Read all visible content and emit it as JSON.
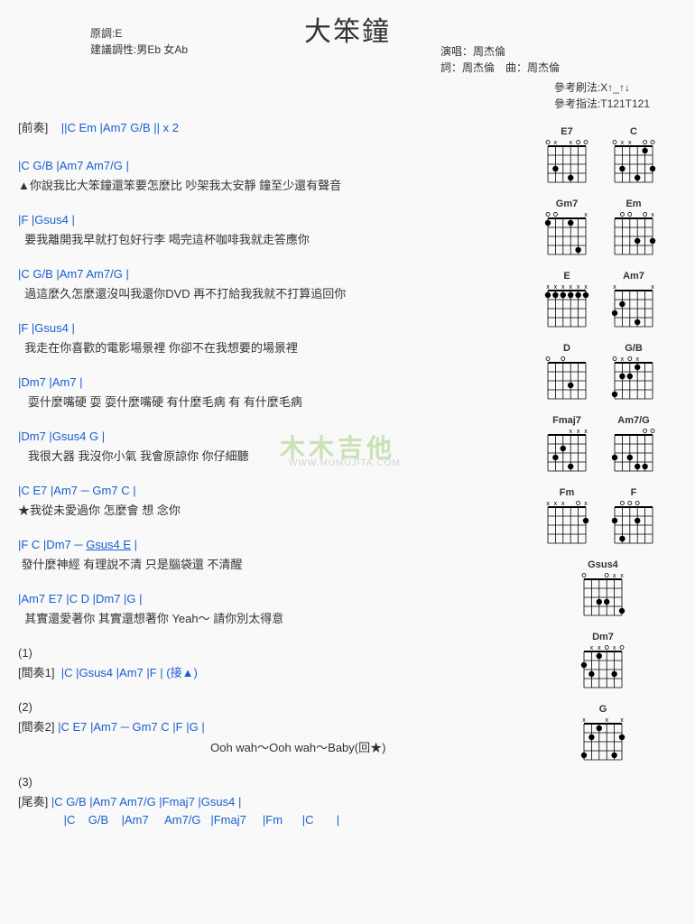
{
  "title": "大笨鐘",
  "meta_left": {
    "line1": "原調:E",
    "line2": "建議調性:男Eb 女Ab"
  },
  "meta_right": {
    "line1": "演唱：周杰倫",
    "line2": "詞：周杰倫　曲：周杰倫"
  },
  "meta_right2": {
    "line1": "參考刷法:X↑_↑↓",
    "line2": "參考指法:T121T121"
  },
  "watermark": "木木吉他",
  "watermark_sub": "WWW.MUMUJITA.COM",
  "intro": {
    "label": "[前奏]",
    "chords": "||C  Em      |Am7  G/B     || x 2"
  },
  "verses": [
    {
      "chords": "|C                   G/B               |Am7                   Am7/G            |",
      "lyrics": "▲你說我比大笨鐘還笨要怎麼比    吵架我太安靜 鐘至少還有聲音"
    },
    {
      "chords": "|F                                     |Gsus4                                   |",
      "lyrics": "要我離開我早就打包好行李    喝完這杯咖啡我就走答應你"
    },
    {
      "chords": "|C                        G/B              |Am7                  Am7/G            |",
      "lyrics": "過這麼久怎麼還沒叫我還你DVD    再不打給我我就不打算追回你"
    },
    {
      "chords": "|F                                     |Gsus4                                   |",
      "lyrics": "我走在你喜歡的電影場景裡    你卻不在我想要的場景裡"
    },
    {
      "chords": "|Dm7                                |Am7                                    |",
      "lyrics": "耍什麼嘴硬 耍 耍什麼嘴硬    有什麼毛病 有 有什麼毛病"
    },
    {
      "chords": "|Dm7                                |Gsus4      G                          |",
      "lyrics": "我很大器    我沒你小氣    我會原諒你    你仔細聽"
    },
    {
      "chords": "|C         E7         |Am7  ─  Gm7      C      |",
      "lyrics": "★我從未愛過你    怎麼會        想 念你"
    },
    {
      "chords_parts": [
        "|F             C              |Dm7  ─  ",
        "Gsus4   E",
        "   |"
      ],
      "lyrics": "發什麼神經   有理說不清 只是腦袋還    不清醒"
    },
    {
      "chords": "|Am7       E7         |C        D         |Dm7       |G                      |",
      "lyrics": "其實還愛著你    其實還想著你    Yeah～ 請你別太得意"
    }
  ],
  "endings": {
    "n1": "(1)",
    "inter1_label": "[間奏1]",
    "inter1": "|C    |Gsus4    |Am7    |F      |  (接▲)",
    "n2": "(2)",
    "inter2_label": "[間奏2]",
    "inter2": "  |C    E7    |Am7  ─  Gm7   C    |F        |G                       |",
    "inter2_lyrics": "                                                           Ooh wah～Ooh wah～Baby(回★)",
    "n3": "(3)",
    "outro_label": "[尾奏]",
    "outro1": "  |C    G/B    |Am7     Am7/G   |Fmaj7     |Gsus4    |",
    "outro2": "              |C    G/B    |Am7     Am7/G   |Fmaj7     |Fm      |C       |"
  },
  "chord_diagrams": [
    "E7",
    "C",
    "Gm7",
    "Em",
    "E",
    "Am7",
    "D",
    "G/B",
    "Fmaj7",
    "Am7/G",
    "Fm",
    "F",
    "Gsus4",
    "Dm7",
    "G"
  ]
}
